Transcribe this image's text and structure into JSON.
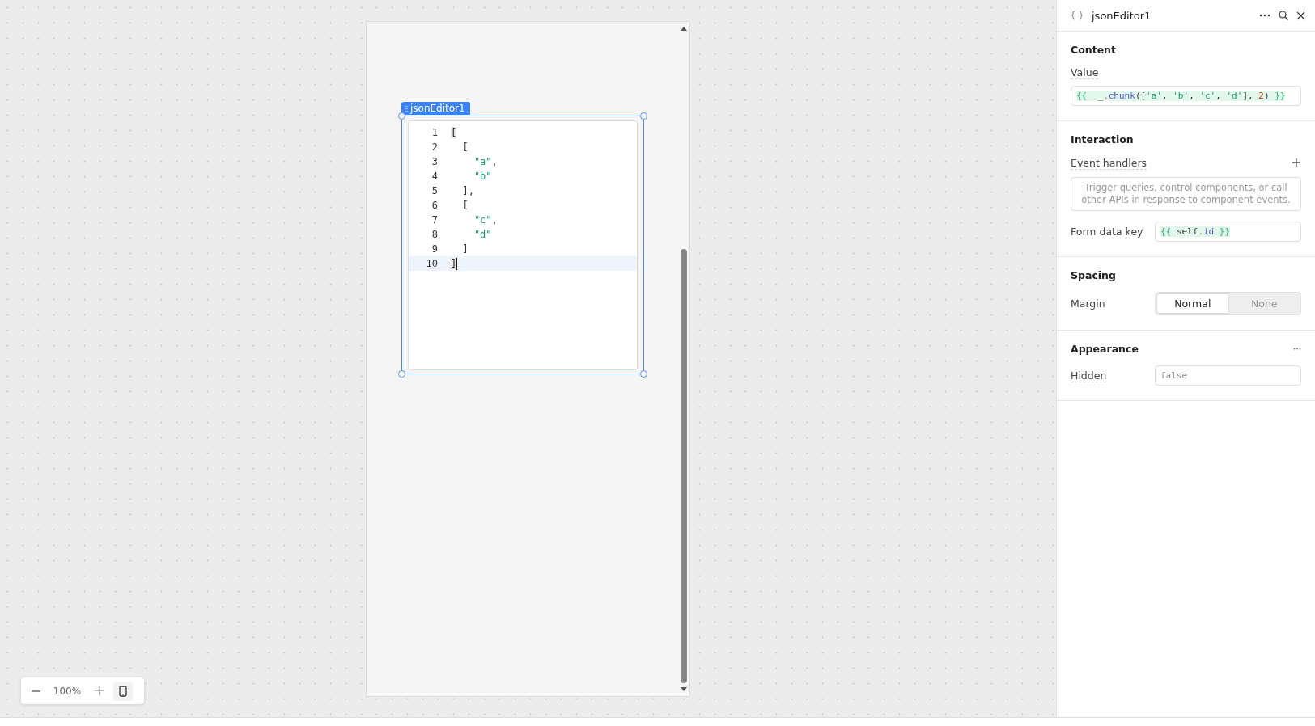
{
  "canvas": {
    "component_label": "jsonEditor1",
    "editor": {
      "lines": [
        {
          "number": "1",
          "selected": false,
          "tokens": [
            {
              "kind": "bracket",
              "text": "["
            }
          ]
        },
        {
          "number": "2",
          "selected": false,
          "tokens": [
            {
              "kind": "punct",
              "text": "  ["
            }
          ]
        },
        {
          "number": "3",
          "selected": false,
          "tokens": [
            {
              "kind": "string",
              "text": "    \"a\""
            },
            {
              "kind": "punct",
              "text": ","
            }
          ]
        },
        {
          "number": "4",
          "selected": false,
          "tokens": [
            {
              "kind": "string",
              "text": "    \"b\""
            }
          ]
        },
        {
          "number": "5",
          "selected": false,
          "tokens": [
            {
              "kind": "punct",
              "text": "  ],"
            }
          ]
        },
        {
          "number": "6",
          "selected": false,
          "tokens": [
            {
              "kind": "punct",
              "text": "  ["
            }
          ]
        },
        {
          "number": "7",
          "selected": false,
          "tokens": [
            {
              "kind": "string",
              "text": "    \"c\""
            },
            {
              "kind": "punct",
              "text": ","
            }
          ]
        },
        {
          "number": "8",
          "selected": false,
          "tokens": [
            {
              "kind": "string",
              "text": "    \"d\""
            }
          ]
        },
        {
          "number": "9",
          "selected": false,
          "tokens": [
            {
              "kind": "punct",
              "text": "  ]"
            }
          ]
        },
        {
          "number": "10",
          "selected": true,
          "tokens": [
            {
              "kind": "bracket",
              "text": "]"
            }
          ]
        }
      ]
    },
    "zoom": {
      "value": "100%"
    }
  },
  "inspector": {
    "title": "jsonEditor1",
    "sections": [
      {
        "title": "Content",
        "fields": [
          {
            "kind": "code",
            "label": "Value",
            "tokens": [
              {
                "kind": "brace",
                "text": "{{  "
              },
              {
                "kind": "punct",
                "text": "_"
              },
              {
                "kind": "dot",
                "text": "."
              },
              {
                "kind": "func",
                "text": "chunk"
              },
              {
                "kind": "punct",
                "text": "(["
              },
              {
                "kind": "string",
                "text": "'a'"
              },
              {
                "kind": "punct",
                "text": ", "
              },
              {
                "kind": "string",
                "text": "'b'"
              },
              {
                "kind": "punct",
                "text": ", "
              },
              {
                "kind": "string",
                "text": "'c'"
              },
              {
                "kind": "punct",
                "text": ", "
              },
              {
                "kind": "string",
                "text": "'d'"
              },
              {
                "kind": "punct",
                "text": "], "
              },
              {
                "kind": "number",
                "text": "2"
              },
              {
                "kind": "punct",
                "text": ") "
              },
              {
                "kind": "brace",
                "text": "}}"
              }
            ]
          }
        ]
      },
      {
        "title": "Interaction",
        "fields": [
          {
            "kind": "handlers",
            "label": "Event handlers",
            "placeholder": "Trigger queries, control components, or call other APIs in response to component events."
          },
          {
            "kind": "inline-code",
            "label": "Form data key",
            "tokens": [
              {
                "kind": "brace",
                "text": "{{ "
              },
              {
                "kind": "punct",
                "text": "self"
              },
              {
                "kind": "dot",
                "text": "."
              },
              {
                "kind": "func",
                "text": "id"
              },
              {
                "kind": "brace",
                "text": " }}"
              }
            ]
          }
        ]
      },
      {
        "title": "Spacing",
        "fields": [
          {
            "kind": "segmented",
            "label": "Margin",
            "options": [
              {
                "label": "Normal",
                "selected": true
              },
              {
                "label": "None",
                "selected": false
              }
            ]
          }
        ]
      },
      {
        "title": "Appearance",
        "menu": true,
        "fields": [
          {
            "kind": "input",
            "label": "Hidden",
            "placeholder": "false"
          }
        ]
      }
    ]
  }
}
